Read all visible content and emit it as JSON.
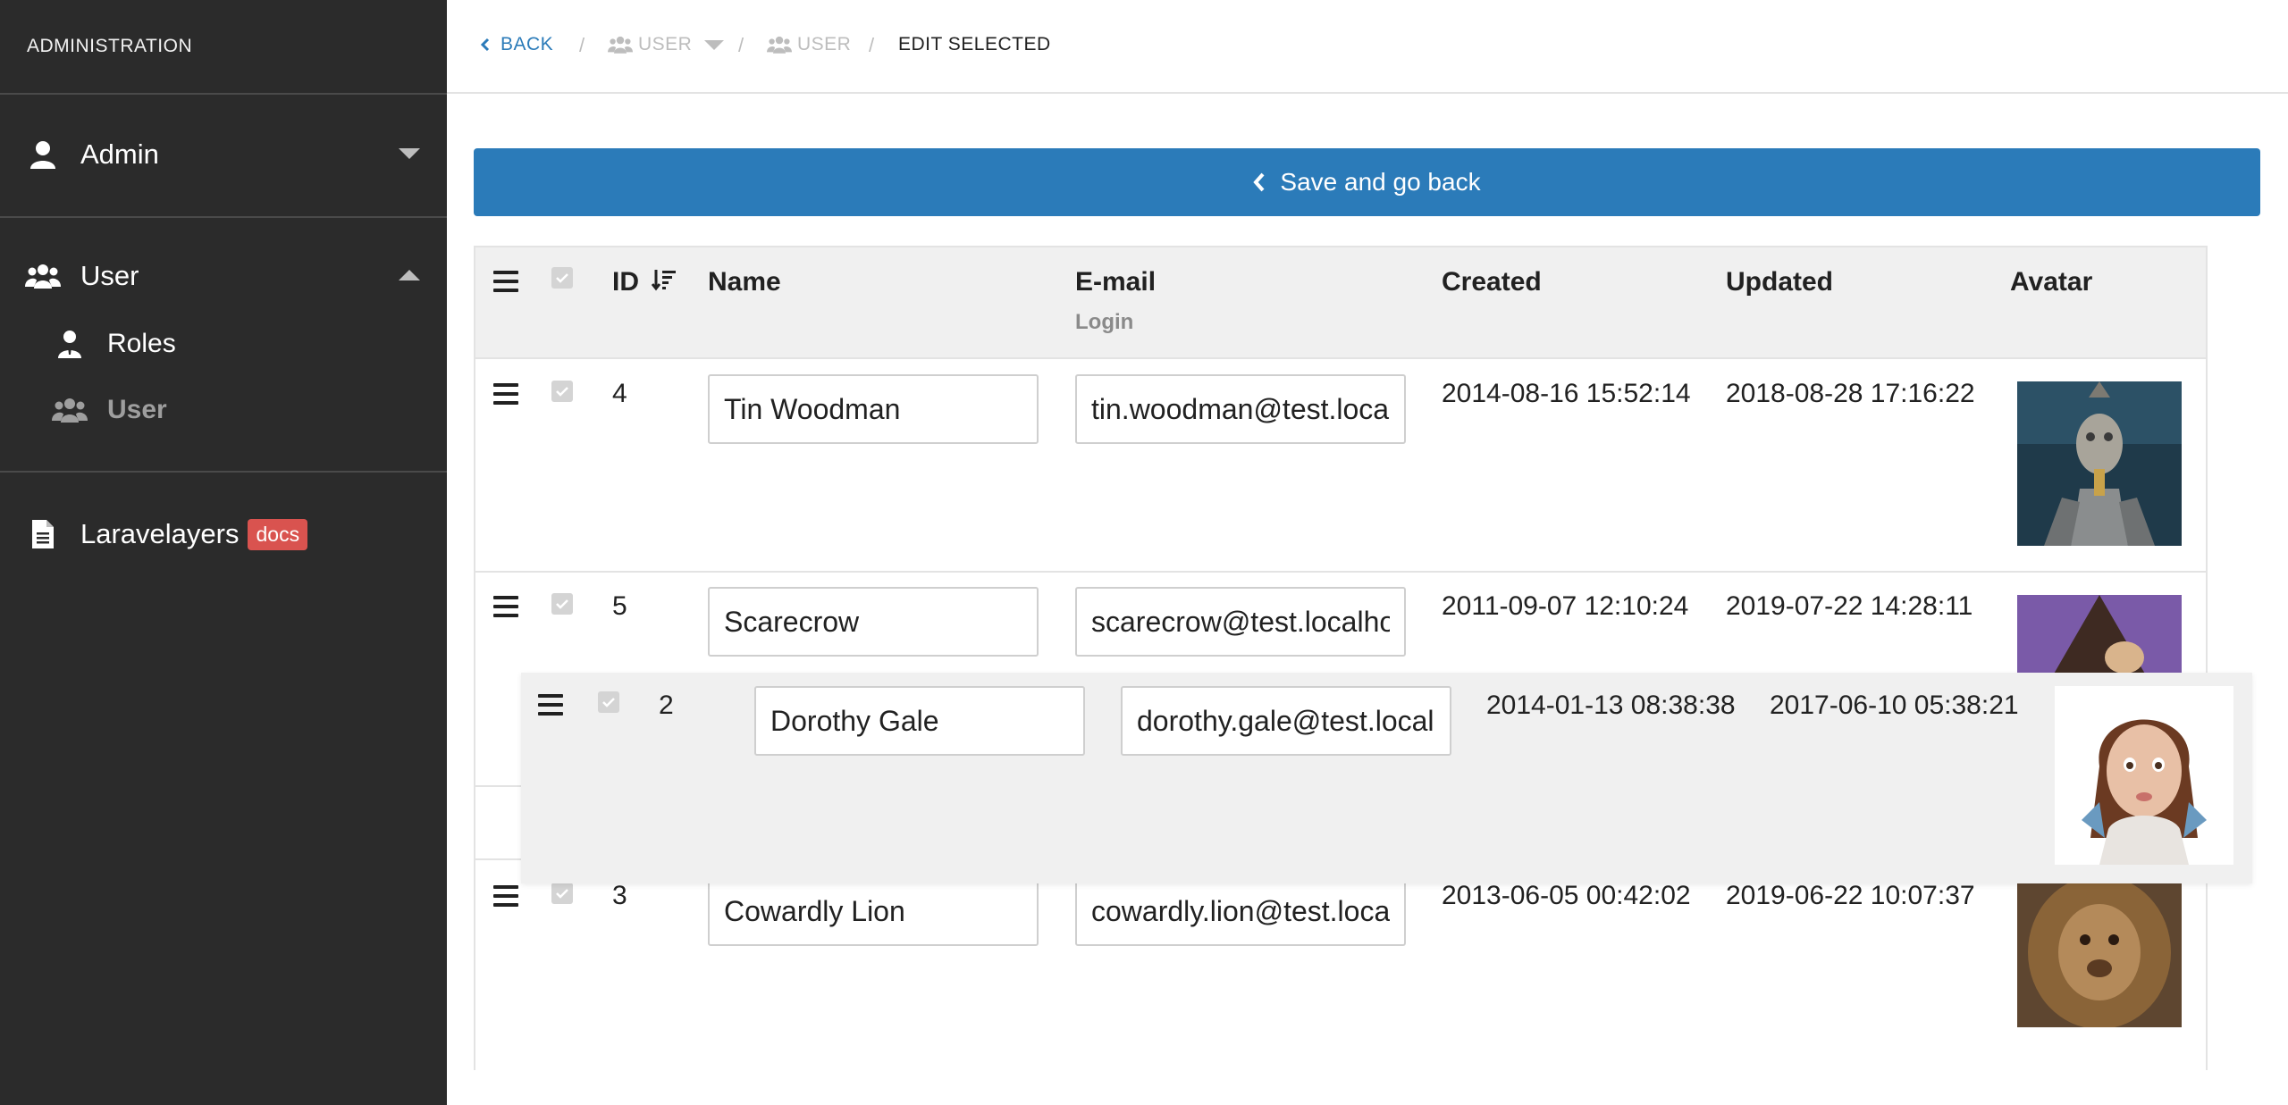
{
  "sidebar": {
    "title": "ADMINISTRATION",
    "admin_label": "Admin",
    "user_label": "User",
    "roles_label": "Roles",
    "user_sub_label": "User",
    "docs_label": "Laravelayers",
    "docs_badge": "docs"
  },
  "breadcrumb": {
    "back": "BACK",
    "user_dropdown": "USER",
    "user": "USER",
    "current": "EDIT SELECTED"
  },
  "save_button": "Save and go back",
  "table": {
    "headers": {
      "id": "ID",
      "name": "Name",
      "email": "E-mail",
      "email_sub": "Login",
      "created": "Created",
      "updated": "Updated",
      "avatar": "Avatar"
    },
    "rows": [
      {
        "id": "4",
        "name": "Tin Woodman",
        "email": "tin.woodman@test.localhost",
        "created": "2014-08-16 15:52:14",
        "updated": "2018-08-28 17:16:22",
        "avatar": "tin-woodman-avatar"
      },
      {
        "id": "5",
        "name": "Scarecrow",
        "email": "scarecrow@test.localhost",
        "created": "2011-09-07 12:10:24",
        "updated": "2019-07-22 14:28:11",
        "avatar": "scarecrow-avatar"
      },
      {
        "id": "3",
        "name": "Cowardly Lion",
        "email": "cowardly.lion@test.localhost",
        "created": "2013-06-05 00:42:02",
        "updated": "2019-06-22 10:07:37",
        "avatar": "cowardly-lion-avatar"
      }
    ],
    "dragging_row": {
      "id": "2",
      "name": "Dorothy Gale",
      "email": "dorothy.gale@test.localhost",
      "created": "2014-01-13 08:38:38",
      "updated": "2017-06-10 05:38:21",
      "avatar": "dorothy-gale-avatar"
    }
  },
  "colors": {
    "sidebar_bg": "#2b2b2b",
    "primary": "#2b7bb9",
    "badge": "#d9534f"
  }
}
